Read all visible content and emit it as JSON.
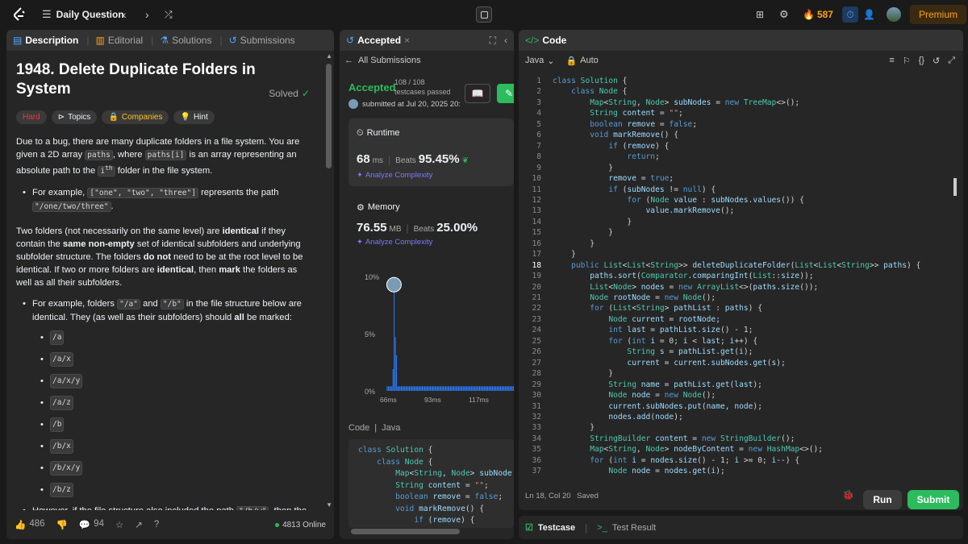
{
  "topbar": {
    "title": "Daily Question",
    "streak": "587",
    "premium": "Premium"
  },
  "left": {
    "tabs": [
      "Description",
      "Editorial",
      "Solutions",
      "Submissions"
    ],
    "title": "1948. Delete Duplicate Folders in System",
    "solved": "Solved",
    "pills": [
      "Hard",
      "Topics",
      "Companies",
      "Hint"
    ],
    "footer": {
      "likes": "486",
      "comments": "94",
      "online": "4813 Online"
    }
  },
  "middle": {
    "tab": "Accepted",
    "back": "All Submissions",
    "status": "Accepted",
    "testcases": "108 / 108",
    "testcases_label": "testcases passed",
    "submitted": "submitted at Jul 20, 2025 20:",
    "runtime": {
      "label": "Runtime",
      "value": "68",
      "unit": "ms",
      "beats_label": "Beats",
      "beats": "95.45%",
      "analyze": "Analyze Complexity"
    },
    "memory": {
      "label": "Memory",
      "value": "76.55",
      "unit": "MB",
      "beats_label": "Beats",
      "beats": "25.00%",
      "analyze": "Analyze Complexity"
    },
    "chart_data": {
      "type": "bar",
      "ylabels": [
        "10%",
        "5%",
        "0%"
      ],
      "xlabels": [
        "66ms",
        "93ms",
        "117ms"
      ],
      "values": [
        0.4,
        0.4,
        0.4,
        0.4,
        0.4,
        1.9,
        8.7,
        4.7,
        3.1,
        0.4,
        0.4,
        0.4,
        0.4,
        0.4,
        0.4,
        0.4,
        0.4,
        0.4,
        0.4,
        0.4,
        0.4,
        0.4,
        0.4,
        0.4,
        0.4,
        0.4,
        0.4,
        0.4,
        0.4,
        0.4,
        0.4,
        0.4,
        0.4,
        0.4,
        0.4,
        0.4,
        0.4,
        0.4,
        0.4,
        0.4,
        0.4,
        0.4,
        0.4,
        0.4,
        0.4,
        0.4,
        0.4,
        0.4,
        0.4,
        0.4,
        0.4,
        0.4,
        0.4,
        0.4,
        0.4,
        0.4,
        0.4,
        0.4,
        0.4,
        0.4,
        0.4,
        0.4,
        0.4,
        0.4,
        0.4,
        0.4,
        0.4,
        0.4,
        0.4,
        0.4,
        0.4,
        0.4,
        0.4,
        0.4,
        0.4,
        0.4,
        0.4,
        0.4,
        0.4,
        0.4,
        0.4,
        0.4,
        0.4,
        0.4,
        0.4,
        0.4,
        0.4,
        0.4,
        0.4,
        0.4,
        0.4,
        0.4,
        0.4,
        0.4,
        0.4,
        0.4,
        0.4,
        0.4,
        0.4,
        0.4,
        0.4,
        0.4,
        0.4,
        0.4,
        0.4,
        0.4,
        0.4,
        0.4,
        0.4
      ],
      "ylim": [
        0,
        10
      ]
    },
    "code_label": "Code",
    "code_lang": "Java",
    "code_lines": [
      "class Solution {",
      "    class Node {",
      "        Map<String, Node> subNode",
      "        String content = \"\";",
      "        boolean remove = false;",
      "        void markRemove() {",
      "            if (remove) {"
    ]
  },
  "right": {
    "tab": "Code",
    "lang": "Java",
    "mode": "Auto",
    "status": "Ln 18, Col 20",
    "saved": "Saved",
    "run": "Run",
    "submit": "Submit",
    "testcase": "Testcase",
    "result": "Test Result",
    "lines": [
      "class Solution {",
      "    class Node {",
      "        Map<String, Node> subNodes = new TreeMap<>();",
      "        String content = \"\";",
      "        boolean remove = false;",
      "        void markRemove() {",
      "            if (remove) {",
      "                return;",
      "            }",
      "            remove = true;",
      "            if (subNodes != null) {",
      "                for (Node value : subNodes.values()) {",
      "                    value.markRemove();",
      "                }",
      "            }",
      "        }",
      "    }",
      "    public List<List<String>> deleteDuplicateFolder(List<List<String>> paths) {",
      "        paths.sort(Comparator.comparingInt(List::size));",
      "        List<Node> nodes = new ArrayList<>(paths.size());",
      "        Node rootNode = new Node();",
      "        for (List<String> pathList : paths) {",
      "            Node current = rootNode;",
      "            int last = pathList.size() - 1;",
      "            for (int i = 0; i < last; i++) {",
      "                String s = pathList.get(i);",
      "                current = current.subNodes.get(s);",
      "            }",
      "            String name = pathList.get(last);",
      "            Node node = new Node();",
      "            current.subNodes.put(name, node);",
      "            nodes.add(node);",
      "        }",
      "        StringBuilder content = new StringBuilder();",
      "        Map<String, Node> nodeByContent = new HashMap<>();",
      "        for (int i = nodes.size() - 1; i >= 0; i--) {",
      "            Node node = nodes.get(i);"
    ]
  }
}
